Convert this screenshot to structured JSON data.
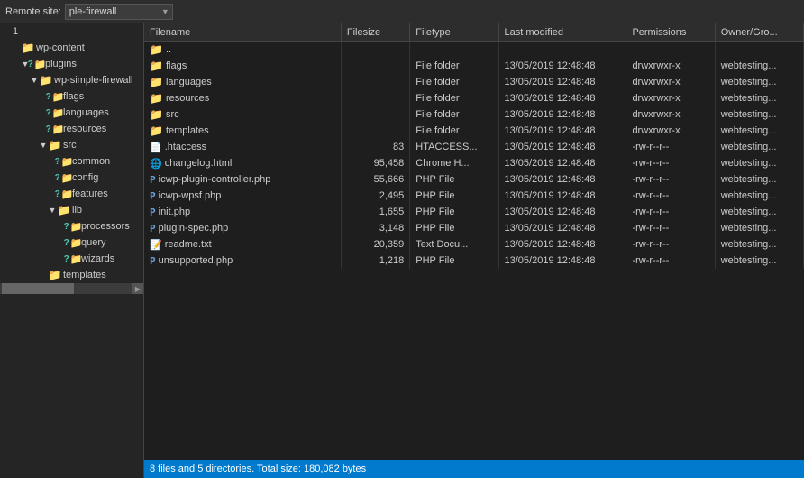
{
  "topbar": {
    "label": "Remote site:",
    "site_value": "ple-firewall",
    "dropdown_arrow": "▼"
  },
  "tree": {
    "items": [
      {
        "id": "1",
        "label": "1",
        "indent": 0,
        "type": "text",
        "toggle": "",
        "icon": "none"
      },
      {
        "id": "wp-content",
        "label": "wp-content",
        "indent": 1,
        "type": "folder",
        "toggle": "",
        "icon": "folder"
      },
      {
        "id": "plugins",
        "label": "plugins",
        "indent": 2,
        "type": "folder",
        "toggle": "▼",
        "icon": "folder-q"
      },
      {
        "id": "wp-simple-firewall",
        "label": "wp-simple-firewall",
        "indent": 3,
        "type": "folder",
        "toggle": "▼",
        "icon": "folder"
      },
      {
        "id": "flags",
        "label": "flags",
        "indent": 4,
        "type": "folder",
        "toggle": "",
        "icon": "folder-q"
      },
      {
        "id": "languages",
        "label": "languages",
        "indent": 4,
        "type": "folder",
        "toggle": "",
        "icon": "folder-q"
      },
      {
        "id": "resources",
        "label": "resources",
        "indent": 4,
        "type": "folder",
        "toggle": "",
        "icon": "folder-q"
      },
      {
        "id": "src",
        "label": "src",
        "indent": 4,
        "type": "folder",
        "toggle": "▼",
        "icon": "folder"
      },
      {
        "id": "common",
        "label": "common",
        "indent": 5,
        "type": "folder",
        "toggle": "",
        "icon": "folder-q"
      },
      {
        "id": "config",
        "label": "config",
        "indent": 5,
        "type": "folder",
        "toggle": "",
        "icon": "folder-q"
      },
      {
        "id": "features",
        "label": "features",
        "indent": 5,
        "type": "folder",
        "toggle": "",
        "icon": "folder-q"
      },
      {
        "id": "lib",
        "label": "lib",
        "indent": 5,
        "type": "folder",
        "toggle": "▼",
        "icon": "folder"
      },
      {
        "id": "processors",
        "label": "processors",
        "indent": 6,
        "type": "folder",
        "toggle": "",
        "icon": "folder-q"
      },
      {
        "id": "query",
        "label": "query",
        "indent": 6,
        "type": "folder",
        "toggle": "",
        "icon": "folder-q"
      },
      {
        "id": "wizards",
        "label": "wizards",
        "indent": 6,
        "type": "folder",
        "toggle": "",
        "icon": "folder-q"
      },
      {
        "id": "templates",
        "label": "templates",
        "indent": 4,
        "type": "folder",
        "toggle": "",
        "icon": "folder"
      }
    ]
  },
  "files": {
    "columns": [
      "Filename",
      "Filesize",
      "Filetype",
      "Last modified",
      "Permissions",
      "Owner/Gro..."
    ],
    "rows": [
      {
        "name": "..",
        "size": "",
        "type": "",
        "modified": "",
        "permissions": "",
        "owner": "",
        "icon": "folder"
      },
      {
        "name": "flags",
        "size": "",
        "type": "File folder",
        "modified": "13/05/2019 12:48:48",
        "permissions": "drwxrwxr-x",
        "owner": "webtesting...",
        "icon": "folder"
      },
      {
        "name": "languages",
        "size": "",
        "type": "File folder",
        "modified": "13/05/2019 12:48:48",
        "permissions": "drwxrwxr-x",
        "owner": "webtesting...",
        "icon": "folder"
      },
      {
        "name": "resources",
        "size": "",
        "type": "File folder",
        "modified": "13/05/2019 12:48:48",
        "permissions": "drwxrwxr-x",
        "owner": "webtesting...",
        "icon": "folder"
      },
      {
        "name": "src",
        "size": "",
        "type": "File folder",
        "modified": "13/05/2019 12:48:48",
        "permissions": "drwxrwxr-x",
        "owner": "webtesting...",
        "icon": "folder"
      },
      {
        "name": "templates",
        "size": "",
        "type": "File folder",
        "modified": "13/05/2019 12:48:48",
        "permissions": "drwxrwxr-x",
        "owner": "webtesting...",
        "icon": "folder"
      },
      {
        "name": ".htaccess",
        "size": "83",
        "type": "HTACCESS...",
        "modified": "13/05/2019 12:48:48",
        "permissions": "-rw-r--r--",
        "owner": "webtesting...",
        "icon": "htaccess"
      },
      {
        "name": "changelog.html",
        "size": "95,458",
        "type": "Chrome H...",
        "modified": "13/05/2019 12:48:48",
        "permissions": "-rw-r--r--",
        "owner": "webtesting...",
        "icon": "html"
      },
      {
        "name": "icwp-plugin-controller.php",
        "size": "55,666",
        "type": "PHP File",
        "modified": "13/05/2019 12:48:48",
        "permissions": "-rw-r--r--",
        "owner": "webtesting...",
        "icon": "php"
      },
      {
        "name": "icwp-wpsf.php",
        "size": "2,495",
        "type": "PHP File",
        "modified": "13/05/2019 12:48:48",
        "permissions": "-rw-r--r--",
        "owner": "webtesting...",
        "icon": "php"
      },
      {
        "name": "init.php",
        "size": "1,655",
        "type": "PHP File",
        "modified": "13/05/2019 12:48:48",
        "permissions": "-rw-r--r--",
        "owner": "webtesting...",
        "icon": "php"
      },
      {
        "name": "plugin-spec.php",
        "size": "3,148",
        "type": "PHP File",
        "modified": "13/05/2019 12:48:48",
        "permissions": "-rw-r--r--",
        "owner": "webtesting...",
        "icon": "php"
      },
      {
        "name": "readme.txt",
        "size": "20,359",
        "type": "Text Docu...",
        "modified": "13/05/2019 12:48:48",
        "permissions": "-rw-r--r--",
        "owner": "webtesting...",
        "icon": "text"
      },
      {
        "name": "unsupported.php",
        "size": "1,218",
        "type": "PHP File",
        "modified": "13/05/2019 12:48:48",
        "permissions": "-rw-r--r--",
        "owner": "webtesting...",
        "icon": "php"
      }
    ]
  },
  "statusbar": {
    "text": "8 files and 5 directories. Total size: 180,082 bytes"
  }
}
